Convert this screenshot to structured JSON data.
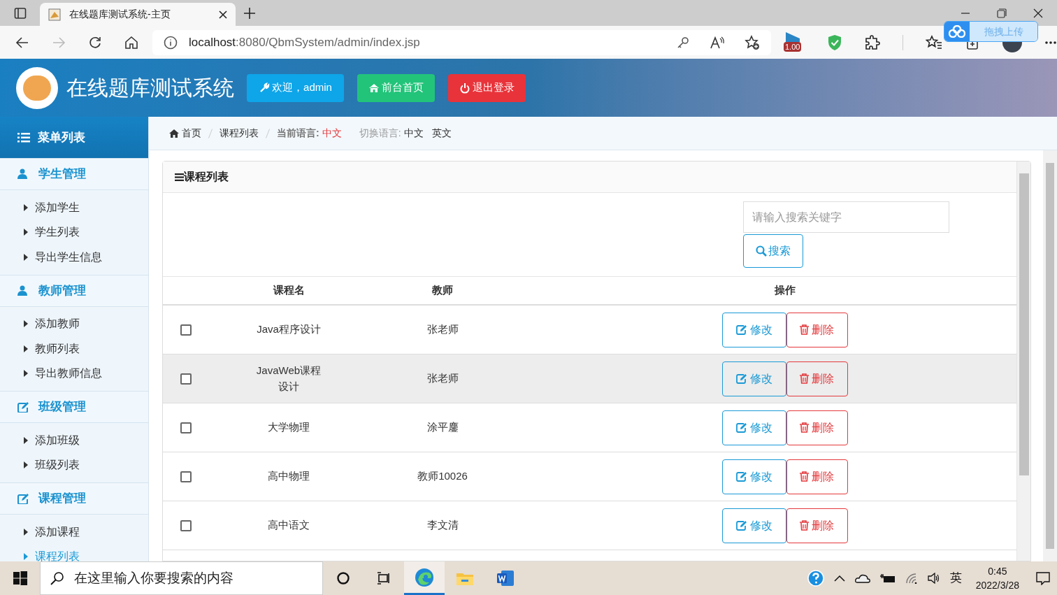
{
  "browser": {
    "tab_title": "在线题库测试系统-主页",
    "url_host": "localhost",
    "url_path": ":8080/QbmSystem/admin/index.jsp",
    "extension_badge": "1.00",
    "upload_widget": "拖拽上传"
  },
  "header": {
    "title": "在线题库测试系统",
    "buttons": [
      {
        "kind": "welcome",
        "label": "欢迎，admin"
      },
      {
        "kind": "home",
        "label": "前台首页"
      },
      {
        "kind": "logout",
        "label": "退出登录"
      }
    ]
  },
  "sidebar": {
    "title": "菜单列表",
    "sections": [
      {
        "title": "学生管理",
        "kind": "user",
        "children": [
          {
            "label": "添加学生",
            "selected": false
          },
          {
            "label": "学生列表",
            "selected": false
          },
          {
            "label": "导出学生信息",
            "selected": false
          }
        ]
      },
      {
        "title": "教师管理",
        "kind": "user",
        "children": [
          {
            "label": "添加教师",
            "selected": false
          },
          {
            "label": "教师列表",
            "selected": false
          },
          {
            "label": "导出教师信息",
            "selected": false
          }
        ]
      },
      {
        "title": "班级管理",
        "kind": "edit",
        "children": [
          {
            "label": "添加班级",
            "selected": false
          },
          {
            "label": "班级列表",
            "selected": false
          }
        ]
      },
      {
        "title": "课程管理",
        "kind": "edit",
        "children": [
          {
            "label": "添加课程",
            "selected": false
          },
          {
            "label": "课程列表",
            "selected": true
          }
        ]
      }
    ]
  },
  "breadcrumb": {
    "items": [
      "首页",
      "课程列表"
    ],
    "current_language_label": "当前语言:",
    "current_language": "中文",
    "switch_label": "切换语言:",
    "languages": [
      "中文",
      "英文"
    ]
  },
  "panel": {
    "title": "课程列表",
    "search": {
      "placeholder": "请输入搜索关键字",
      "button": "搜索"
    },
    "table": {
      "columns": [
        "课程名",
        "教师",
        "操作"
      ],
      "rows": [
        {
          "checked": false,
          "hovered": false,
          "name": "Java程序设计",
          "teacher": "张老师",
          "actions": [
            "修改",
            "删除"
          ]
        },
        {
          "checked": false,
          "hovered": true,
          "name": "JavaWeb课程设计",
          "teacher": "张老师",
          "actions": [
            "修改",
            "删除"
          ]
        },
        {
          "checked": false,
          "hovered": false,
          "name": "大学物理",
          "teacher": "涂平鏖",
          "actions": [
            "修改",
            "删除"
          ]
        },
        {
          "checked": false,
          "hovered": false,
          "name": "高中物理",
          "teacher": "教师10026",
          "actions": [
            "修改",
            "删除"
          ]
        },
        {
          "checked": false,
          "hovered": false,
          "name": "高中语文",
          "teacher": "李文清",
          "actions": [
            "修改",
            "删除"
          ]
        }
      ]
    }
  },
  "taskbar": {
    "search_placeholder": "在这里输入你要搜索的内容",
    "ime": "英",
    "time": "0:45",
    "date": "2022/3/28"
  }
}
